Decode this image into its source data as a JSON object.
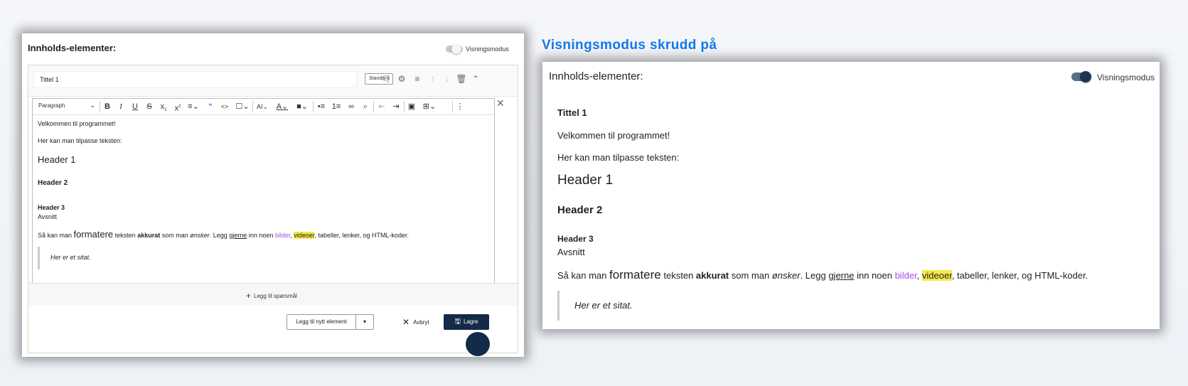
{
  "headline": "Visningsmodus skrudd på",
  "editor_panel": {
    "title": "Innholds-elementer:",
    "view_mode_label": "Visningsmodus",
    "view_mode_on": false,
    "element_title": "Tittel 1",
    "standard_badge": "Standard",
    "paragraph_select": "Paragraph",
    "content": {
      "p1": "Velkommen til programmet!",
      "p2": "Her kan man tilpasse teksten:",
      "h1": "Header 1",
      "h2": "Header 2",
      "h3": "Header 3",
      "avsnitt": "Avsnitt",
      "sentence": {
        "s1": "Så kan man ",
        "formatere": "formatere",
        "s2": " teksten ",
        "akkurat": "akkurat",
        "s3": " som man ",
        "onsker": "ønsker",
        "s4": ". Legg ",
        "gjerne": "gjerne",
        "s5": " inn noen ",
        "bilder": "bilder",
        "s6": ", ",
        "videoer": "videoer",
        "s7": ", tabeller, lenker, og HTML-koder."
      },
      "quote": "Her er et sitat."
    },
    "add_question": "Legg til spørsmål",
    "add_element": "Legg til nytt element",
    "cancel": "Avbryt",
    "save": "Lagre"
  },
  "view_panel": {
    "title": "Innholds-elementer:",
    "view_mode_label": "Visningsmodus",
    "view_mode_on": true,
    "element_title": "Tittel 1",
    "content": {
      "p1": "Velkommen til programmet!",
      "p2": "Her kan man tilpasse teksten:",
      "h1": "Header 1",
      "h2": "Header 2",
      "h3": "Header 3",
      "avsnitt": "Avsnitt",
      "sentence": {
        "s1": "Så kan man ",
        "formatere": "formatere",
        "s2": " teksten ",
        "akkurat": "akkurat",
        "s3": " som man ",
        "onsker": "ønsker",
        "s4": ". Legg ",
        "gjerne": "gjerne",
        "s5": " inn noen ",
        "bilder": "bilder",
        "s6": ", ",
        "videoer": "videoer",
        "s7": ", tabeller, lenker, og HTML-koder."
      },
      "quote": "Her er et sitat."
    }
  },
  "colors": {
    "headline": "#1478ea",
    "save_button": "#132a48",
    "link_purple": "#a64ee0",
    "highlight": "#f5e84a"
  }
}
